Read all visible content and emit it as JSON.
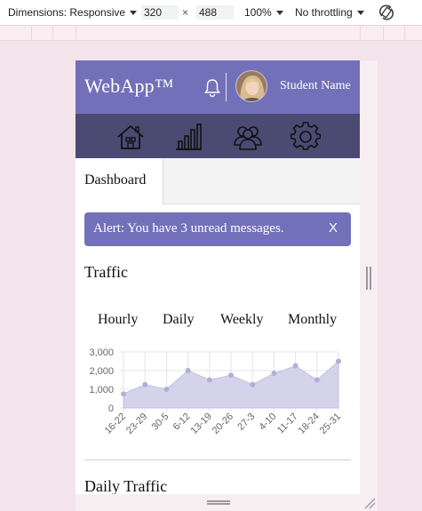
{
  "devtools": {
    "dimensions_label": "Dimensions: Responsive",
    "width_value": "320",
    "times": "×",
    "height_value": "488",
    "zoom": "100%",
    "throttling": "No throttling"
  },
  "app": {
    "brand": "WebApp™",
    "user_name": "Student Name"
  },
  "nav": {
    "icons": [
      "home-icon",
      "bar-chart-icon",
      "users-icon",
      "gear-icon"
    ]
  },
  "tabs": {
    "active": "Dashboard"
  },
  "alert": {
    "text": "Alert: You have 3 unread messages.",
    "close": "X"
  },
  "traffic": {
    "title": "Traffic",
    "ranges": [
      "Hourly",
      "Daily",
      "Weekly",
      "Monthly"
    ]
  },
  "daily": {
    "title": "Daily Traffic"
  },
  "colors": {
    "header": "#7170b9",
    "nav": "#4b4a73",
    "chart_fill": "#d5d3ea",
    "chart_point": "#b2afd6"
  },
  "chart_data": {
    "type": "area",
    "x": [
      "16-22",
      "23-29",
      "30-5",
      "6-12",
      "13-19",
      "20-26",
      "27-3",
      "4-10",
      "11-17",
      "18-24",
      "25-31"
    ],
    "values": [
      750,
      1250,
      1000,
      2000,
      1500,
      1750,
      1250,
      1850,
      2250,
      1500,
      2500
    ],
    "ylim": [
      0,
      3000
    ],
    "yticks": [
      "0",
      "1,000",
      "2,000",
      "3,000"
    ],
    "grid": true
  }
}
